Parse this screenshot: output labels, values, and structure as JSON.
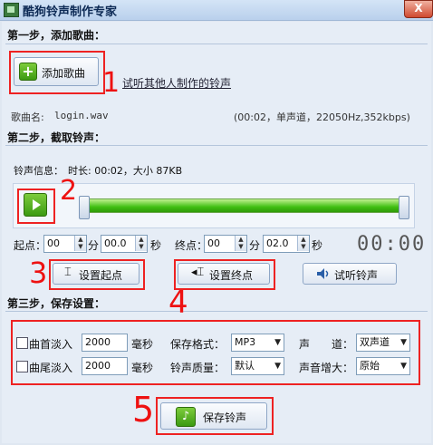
{
  "window": {
    "title": "酷狗铃声制作专家",
    "close": "X"
  },
  "step1": {
    "title": "第一步，添加歌曲：",
    "add_song_label": "添加歌曲",
    "add_icon": "+",
    "link_text": "试听其他人制作的铃声",
    "song_name_label": "歌曲名:",
    "song_name_value": "login.wav",
    "audio_info": "(00:02，单声道，22050Hz,352kbps)"
  },
  "step2": {
    "title": "第二步，截取铃声：",
    "info_label": "铃声信息：",
    "info_value": "时长: 00:02，大小  87KB",
    "play_icon": "play",
    "start_label": "起点：",
    "start_min": "00",
    "min_unit": "分",
    "start_sec": "00.0",
    "sec_unit": "秒",
    "end_label": "终点：",
    "end_min": "00",
    "end_sec": "02.0",
    "timer": "00:00",
    "set_start_label": "设置起点",
    "set_end_label": "设置终点",
    "preview_label": "试听铃声"
  },
  "step3": {
    "title": "第三步，保存设置：",
    "fade_in_label": "曲首淡入",
    "fade_in_value": "2000",
    "fade_out_label": "曲尾淡入",
    "fade_out_value": "2000",
    "ms_unit": "毫秒",
    "format_label": "保存格式：",
    "format_value": "MP3",
    "quality_label": "铃声质量：",
    "quality_value": "默认",
    "channel_label_a": "声",
    "channel_label_b": "道：",
    "channel_value": "双声道",
    "boost_label": "声音增大：",
    "boost_value": "原始",
    "save_label": "保存铃声"
  },
  "annotations": {
    "n1": "1",
    "n2": "2",
    "n3": "3",
    "n4": "4",
    "n5": "5"
  },
  "colors": {
    "accent_red": "#ee2222",
    "progress_green": "#3fbf12"
  }
}
